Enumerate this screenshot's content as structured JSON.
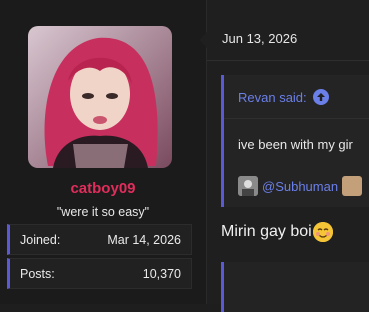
{
  "user": {
    "username": "catboy09",
    "title": "\"were it so easy\"",
    "stats": [
      {
        "label": "Joined:",
        "value": "Mar 14, 2026"
      },
      {
        "label": "Posts:",
        "value": "10,370"
      }
    ]
  },
  "post": {
    "date": "Jun 13, 2026",
    "quote": {
      "author_line": "Revan said:",
      "text": "ive been with my gir",
      "mention": "@Subhuman"
    },
    "reply": "Mirin gay boi"
  },
  "colors": {
    "accent": "#5a5ad6",
    "username": "#e02d5b",
    "link": "#6b7fe8"
  },
  "icons": {
    "jump": "arrow-up-circle-icon",
    "emoji": "smiling-face-icon"
  }
}
